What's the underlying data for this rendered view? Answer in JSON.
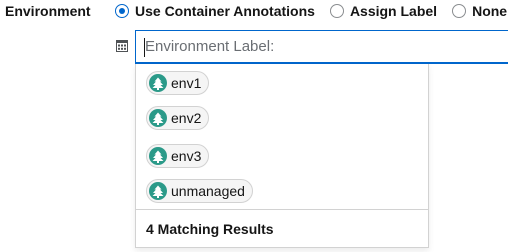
{
  "field": {
    "label": "Environment"
  },
  "radio_options": [
    {
      "label": "Use Container Annotations",
      "selected": true
    },
    {
      "label": "Assign Label",
      "selected": false
    },
    {
      "label": "None",
      "selected": false
    }
  ],
  "input": {
    "placeholder": "Environment Label:",
    "value": "",
    "prefix_icon": "calendar-grid-icon"
  },
  "dropdown": {
    "options": [
      {
        "label": "env1",
        "icon": "tree-icon"
      },
      {
        "label": "env2",
        "icon": "tree-icon"
      },
      {
        "label": "env3",
        "icon": "tree-icon"
      },
      {
        "label": "unmanaged",
        "icon": "tree-icon"
      }
    ],
    "footer": "4 Matching Results"
  },
  "colors": {
    "accent": "#0066cc",
    "chip_icon": "#2b9a89",
    "chip_bg": "#f5f5f5",
    "border": "#d2d2d2"
  }
}
